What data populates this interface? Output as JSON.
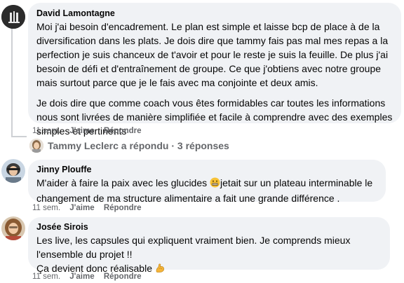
{
  "comments": [
    {
      "author": "David Lamontagne",
      "paragraphs": [
        "Moi j'ai besoin d'encadrement. Le plan est simple et laisse bcp de place à de la diversification dans les plats. Je dois dire que tammy fais pas mal mes repas a la perfection je suis chanceux de t'avoir et pour le reste je suis la feuille. De plus j'ai besoin de défi et d'entraînement de groupe. Ce que j'obtiens avec notre groupe mais surtout parce que je le fais avec ma conjointe et deux amis.",
        "Je dois dire que comme coach vous êtes formidables car toutes les informations nous sont livrées de manière simplifiée et facile à comprendre avec des exemples simples et pertinents"
      ],
      "time": "11 sem.",
      "like_label": "J'aime",
      "reply_label": "Répondre",
      "replies_summary": "Tammy Leclerc a répondu · 3 réponses"
    },
    {
      "author": "Jinny Plouffe",
      "text_before_emoji": "M'aider à faire la paix avec les glucides ",
      "emoji": "grimacing-face",
      "text_after_emoji": "jetait sur un plateau interminable le changement de ma structure alimentaire a fait une grande différence .",
      "time": "11 sem.",
      "like_label": "J'aime",
      "reply_label": "Répondre"
    },
    {
      "author": "Josée Sirois",
      "lines": [
        "Les live, les capsules qui expliquent vraiment bien. Je comprends mieux l'ensemble du projet !!",
        "Ça devient donc réalisable "
      ],
      "emoji": "flexed-biceps",
      "time": "11 sem.",
      "like_label": "J'aime",
      "reply_label": "Répondre"
    }
  ],
  "colors": {
    "bubble": "#f0f2f5",
    "meta_text": "#65676b",
    "thread_line": "#ced0d4"
  }
}
